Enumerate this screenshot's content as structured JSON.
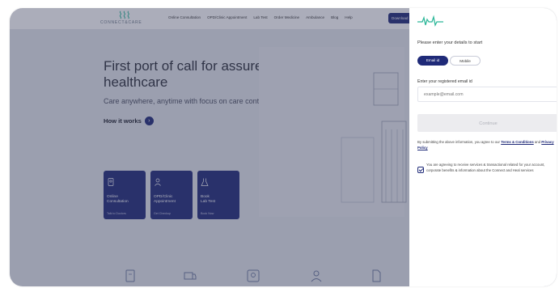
{
  "nav": {
    "logo_text": "CONNECT&CARE",
    "menu": [
      "Online Consultation",
      "OPD/Clinic Appointment",
      "Lab Test",
      "Order Medicine",
      "Ambulance",
      "Blog",
      "Help"
    ],
    "cta": "Download"
  },
  "hero": {
    "title": "First port of call for assured healthcare",
    "subtitle": "Care anywhere, anytime with focus on care continuum",
    "how_it_works": "How it works"
  },
  "cards": [
    {
      "label_line1": "Online",
      "label_line2": "Consultation",
      "link": "Talk to Doctors"
    },
    {
      "label_line1": "OPD/Clinic",
      "label_line2": "Appointment",
      "link": "Get Checkup"
    },
    {
      "label_line1": "Book",
      "label_line2": "Lab Test",
      "link": "Book Now"
    }
  ],
  "panel": {
    "prompt": "Please enter your details to start",
    "toggle": {
      "active": "Email id",
      "inactive": "Mobile"
    },
    "email_label": "Enter your registered email id",
    "email_placeholder": "example@email.com",
    "continue_label": "Continue",
    "terms_text": "By submitting the above information, you agree to our",
    "terms_link": "Terms & Conditions",
    "terms_and": "and",
    "privacy_link": "Privacy Policy",
    "consent_text": "You are agreeing to receive services & transactional related for your account, corporate benefits & information about the Connect and Heal services"
  },
  "colors": {
    "brand_navy": "#1f2a78",
    "logo_green": "#2fb89a"
  }
}
